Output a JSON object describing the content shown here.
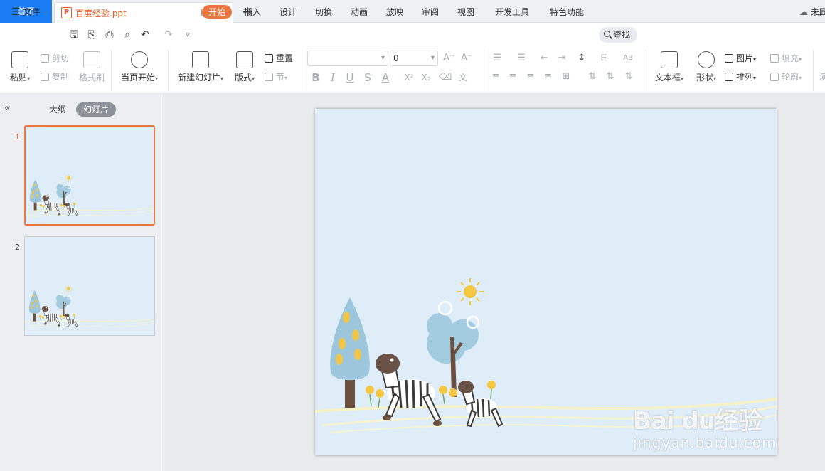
{
  "tabs": {
    "home": "首页",
    "doc": "百度经验.ppt",
    "doc_icon": "ppt-file-icon"
  },
  "menu": {
    "file": "文件",
    "items": [
      "开始",
      "插入",
      "设计",
      "切换",
      "动画",
      "放映",
      "审阅",
      "视图",
      "开发工具",
      "特色功能"
    ],
    "active": "开始",
    "search": "查找",
    "right_text": "未同"
  },
  "ribbon": {
    "paste": "粘贴",
    "cut": "剪切",
    "copy": "复制",
    "format_painter": "格式刷",
    "play_current": "当页开始",
    "new_slide": "新建幻灯片",
    "layout": "版式",
    "reset": "重置",
    "section": "节",
    "font_name": "",
    "font_size": "0",
    "text_box": "文本框",
    "shape": "形状",
    "arrange": "排列",
    "picture": "图片",
    "fill": "填充",
    "outline": "轮廓",
    "cut_off": "演"
  },
  "panel": {
    "outline_tab": "大纲",
    "slides_tab": "幻灯片",
    "slides": [
      {
        "num": "1",
        "selected": true
      },
      {
        "num": "2",
        "selected": false
      }
    ]
  },
  "watermark": {
    "brand": "Bai du经验",
    "site": "jingyan.baidu.com"
  },
  "colors": {
    "accent": "#e9773f",
    "home_tab": "#1a7cf3",
    "slide_bg": "#deedf8"
  }
}
